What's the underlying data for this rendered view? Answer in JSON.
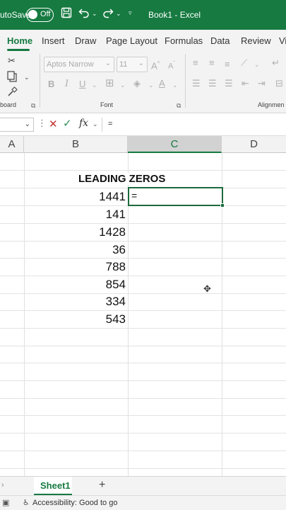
{
  "titlebar": {
    "autosave_label": "utoSave",
    "toggle_label": "Off",
    "doc_title": "Book1 - Excel",
    "bg_color": "#167a41"
  },
  "ribbon_tabs": [
    "Home",
    "Insert",
    "Draw",
    "Page Layout",
    "Formulas",
    "Data",
    "Review",
    "Vi"
  ],
  "ribbon": {
    "font_name": "Aptos Narrow",
    "font_size": "11",
    "group_clipboard": "board",
    "group_font": "Font",
    "group_alignment": "Alignmen"
  },
  "formula_bar": {
    "name_box": "",
    "formula": "="
  },
  "grid": {
    "columns": [
      "A",
      "B",
      "C",
      "D"
    ],
    "selected_column": "C",
    "header_text": "LEADING ZEROS",
    "values": [
      "1441",
      "141",
      "1428",
      "36",
      "788",
      "854",
      "334",
      "543"
    ],
    "active_cell_text": "="
  },
  "sheets": {
    "active": "Sheet1",
    "add": "+"
  },
  "status": {
    "accessibility": "Accessibility: Good to go"
  },
  "icons": {
    "save": "save-icon",
    "undo": "undo-icon",
    "redo": "redo-icon",
    "cut": "scissors-icon",
    "copy": "copy-icon",
    "format_painter": "brush-icon"
  }
}
